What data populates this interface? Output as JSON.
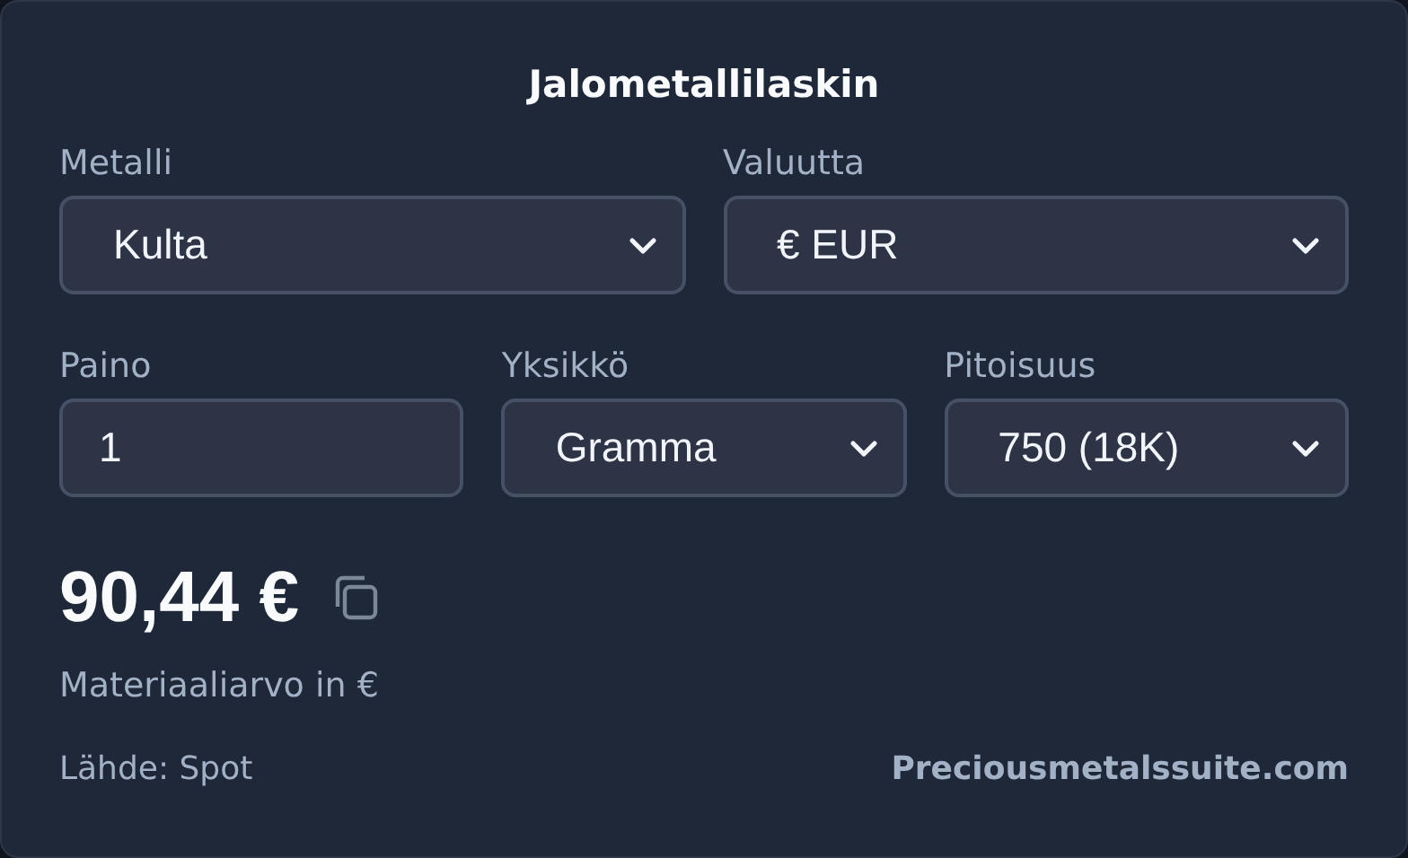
{
  "title": "Jalometallilaskin",
  "rows": [
    [
      {
        "label": "Metalli",
        "kind": "select",
        "value": "Kulta"
      },
      {
        "label": "Valuutta",
        "kind": "select",
        "value": "€ EUR"
      }
    ],
    [
      {
        "label": "Paino",
        "kind": "input",
        "value": "1"
      },
      {
        "label": "Yksikkö",
        "kind": "select",
        "value": "Gramma"
      },
      {
        "label": "Pitoisuus",
        "kind": "select",
        "value": "750 (18K)"
      }
    ]
  ],
  "result": {
    "value": "90,44 €",
    "caption": "Materiaaliarvo in €"
  },
  "footer": {
    "source": "Lähde: Spot",
    "link": "Preciousmetalssuite.com"
  }
}
